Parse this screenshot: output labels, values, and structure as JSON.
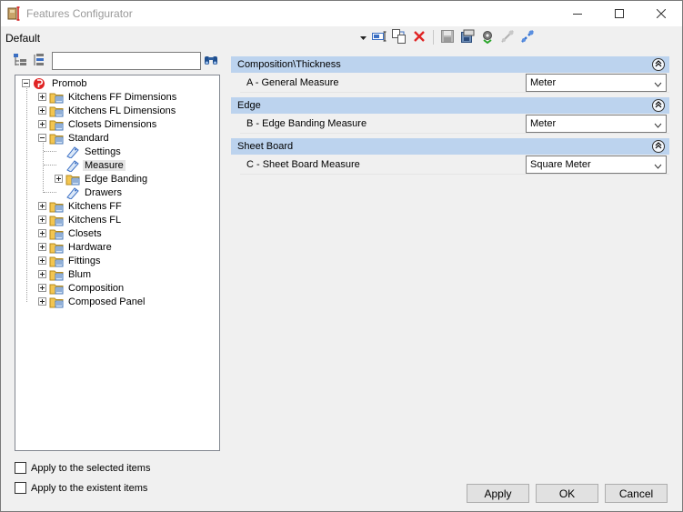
{
  "window": {
    "title": "Features Configurator",
    "icons": {
      "app": "features-configurator-app-icon",
      "minimize": "minimize-icon",
      "maximize": "maximize-icon",
      "close": "close-icon"
    }
  },
  "profile": {
    "label": "Default",
    "dropdown_icon": "dropdown-arrow-icon"
  },
  "toolbar": {
    "icons": [
      "rename-icon",
      "copy-icon",
      "delete-icon",
      "save-icon",
      "export-icon",
      "settings-icon",
      "connect-icon",
      "disconnect-icon"
    ]
  },
  "left_panel": {
    "search": {
      "value": "",
      "placeholder": ""
    },
    "tool_icons": [
      "expand-tree-icon",
      "collapse-tree-icon",
      "find-icon"
    ],
    "tree": {
      "root": "Promob",
      "items": [
        {
          "label": "Kitchens FF Dimensions",
          "level": 1,
          "expander": "plus"
        },
        {
          "label": "Kitchens FL Dimensions",
          "level": 1,
          "expander": "plus"
        },
        {
          "label": "Closets Dimensions",
          "level": 1,
          "expander": "plus"
        },
        {
          "label": "Standard",
          "level": 1,
          "expander": "minus"
        },
        {
          "label": "Settings",
          "level": 2,
          "expander": "none"
        },
        {
          "label": "Measure",
          "level": 2,
          "expander": "none",
          "selected": true
        },
        {
          "label": "Edge Banding",
          "level": 2,
          "expander": "plus"
        },
        {
          "label": "Drawers",
          "level": 2,
          "expander": "none"
        },
        {
          "label": "Kitchens FF",
          "level": 1,
          "expander": "plus"
        },
        {
          "label": "Kitchens FL",
          "level": 1,
          "expander": "plus"
        },
        {
          "label": "Closets",
          "level": 1,
          "expander": "plus"
        },
        {
          "label": "Hardware",
          "level": 1,
          "expander": "plus"
        },
        {
          "label": "Fittings",
          "level": 1,
          "expander": "plus"
        },
        {
          "label": "Blum",
          "level": 1,
          "expander": "plus"
        },
        {
          "label": "Composition",
          "level": 1,
          "expander": "plus"
        },
        {
          "label": "Composed Panel",
          "level": 1,
          "expander": "plus"
        }
      ]
    },
    "checkboxes": [
      {
        "label": "Apply to the selected items",
        "checked": false
      },
      {
        "label": "Apply to the existent items",
        "checked": false
      }
    ]
  },
  "properties": {
    "groups": [
      {
        "header": "Composition\\Thickness",
        "rows": [
          {
            "label": "A - General Measure",
            "value": "Meter"
          }
        ]
      },
      {
        "header": "Edge",
        "rows": [
          {
            "label": "B - Edge Banding Measure",
            "value": "Meter"
          }
        ]
      },
      {
        "header": "Sheet Board",
        "rows": [
          {
            "label": "C - Sheet Board Measure",
            "value": "Square Meter"
          }
        ]
      }
    ]
  },
  "footer": {
    "apply_label": "Apply",
    "ok_label": "OK",
    "cancel_label": "Cancel"
  },
  "colors": {
    "group_header_bg": "#bcd3ee",
    "folder": "#f3c550",
    "delete_red": "#e02424"
  }
}
